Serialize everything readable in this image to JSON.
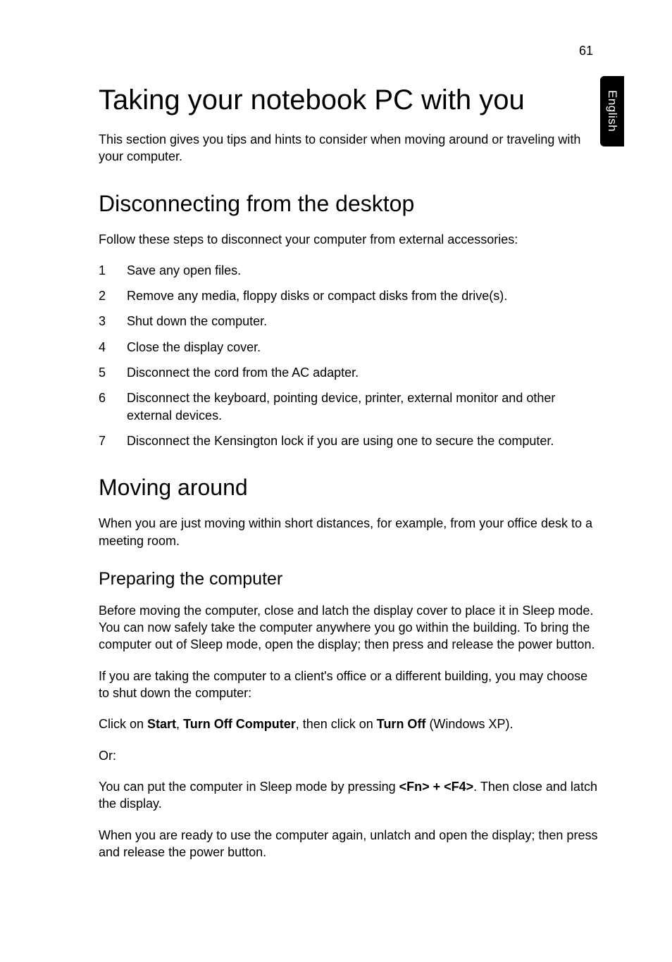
{
  "page_number": "61",
  "side_tab": "English",
  "title": "Taking your notebook PC with you",
  "intro": "This section gives you tips and hints to consider when moving around or traveling with your computer.",
  "sec1": {
    "heading": "Disconnecting from the desktop",
    "lead": "Follow these steps to disconnect your computer from external accessories:",
    "steps": [
      {
        "n": "1",
        "t": "Save any open files."
      },
      {
        "n": "2",
        "t": "Remove any media, floppy disks or compact disks from the drive(s)."
      },
      {
        "n": "3",
        "t": "Shut down the computer."
      },
      {
        "n": "4",
        "t": "Close the display cover."
      },
      {
        "n": "5",
        "t": "Disconnect the cord from the AC adapter."
      },
      {
        "n": "6",
        "t": "Disconnect the keyboard, pointing device, printer, external monitor and other external devices."
      },
      {
        "n": "7",
        "t": "Disconnect the Kensington lock if you are using one to secure the computer."
      }
    ]
  },
  "sec2": {
    "heading": "Moving around",
    "lead": "When you are just moving within short distances, for example, from your office desk to a meeting room.",
    "sub": {
      "heading": "Preparing the computer",
      "p1": "Before moving the computer, close and latch the display cover to place it in Sleep mode. You can now safely take the computer anywhere you go within the building. To bring the computer out of Sleep mode, open the display; then press and release the power button.",
      "p2": "If you are taking the computer to a client's office or a different building, you may choose to shut down the computer:",
      "p3_a": "Click on ",
      "p3_b": "Start",
      "p3_c": ", ",
      "p3_d": "Turn Off Computer",
      "p3_e": ", then click on ",
      "p3_f": "Turn Off",
      "p3_g": " (Windows XP).",
      "p4": "Or:",
      "p5_a": "You can put the computer in Sleep mode by pressing ",
      "p5_b": "<Fn> + <F4>",
      "p5_c": ". Then close and latch the display.",
      "p6": "When you are ready to use the computer again, unlatch and open the display; then press and release the power button."
    }
  }
}
